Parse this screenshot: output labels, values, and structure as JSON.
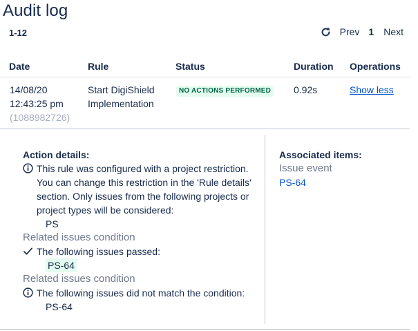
{
  "page": {
    "title": "Audit log",
    "range": "1-12"
  },
  "pager": {
    "refresh_icon": "refresh-icon",
    "prev_label": "Prev",
    "page_number": "1",
    "next_label": "Next"
  },
  "table": {
    "columns": [
      "Date",
      "Rule",
      "Status",
      "Duration",
      "Operations"
    ],
    "row": {
      "date": "14/08/20",
      "time": "12:43:25 pm",
      "id": "(1088982726)",
      "rule_line1": "Start DigiShield",
      "rule_line2": "Implementation",
      "status": "NO ACTIONS PERFORMED",
      "status_color": "#006644",
      "duration": "0.92s",
      "operation": "Show less"
    }
  },
  "action_details": {
    "heading": "Action details:",
    "info_icon": "info-icon",
    "restriction_lines": [
      "This rule was configured with a project restriction.",
      "You can change this restriction in the 'Rule details'",
      "section. Only issues from the following projects or",
      "project types will be considered:"
    ],
    "project": "PS",
    "condition1_title": "Related issues condition",
    "check_icon": "check-icon",
    "condition1_text": "The following issues passed:",
    "condition1_issue": "PS-64",
    "condition2_title": "Related issues condition",
    "condition2_text": "The following issues did not match the condition:",
    "condition2_issue": "PS-64"
  },
  "associated": {
    "heading": "Associated items:",
    "event_label": "Issue event",
    "issue": "PS-64"
  },
  "colors": {
    "link": "#0052cc",
    "success_bg": "#e3fcef",
    "muted": "#6b778c"
  }
}
